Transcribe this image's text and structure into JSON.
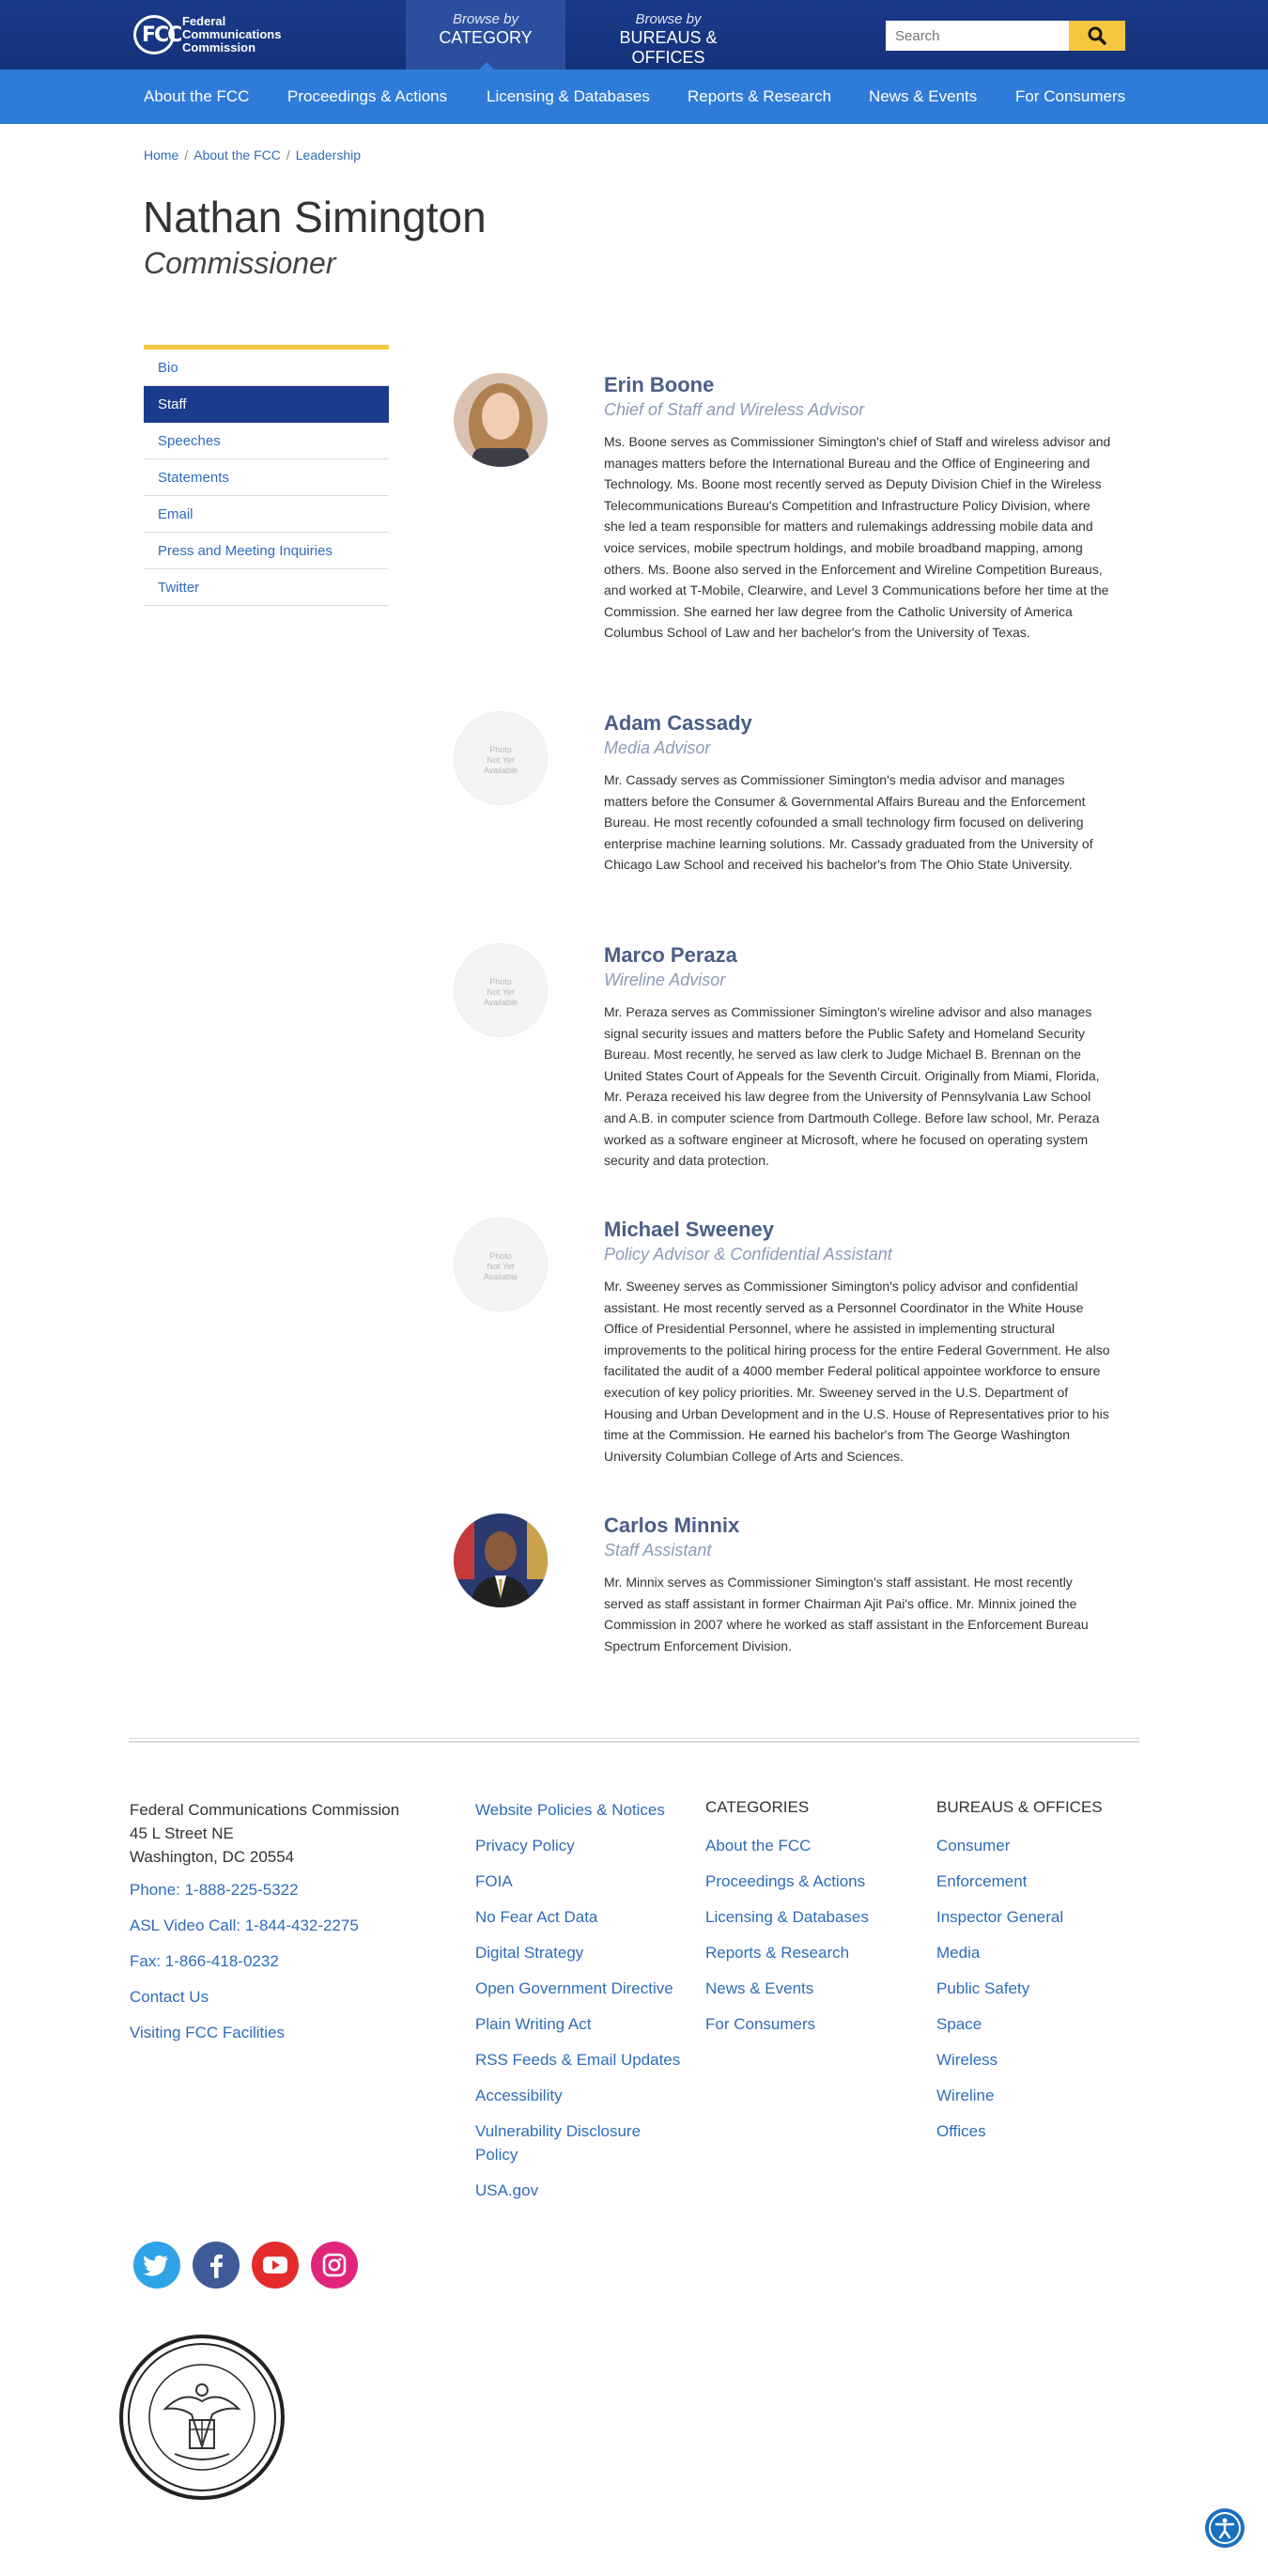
{
  "header": {
    "logo_lines": [
      "Federal",
      "Communications",
      "Commission"
    ],
    "logo_mark": "FCC",
    "browse_category_small": "Browse by",
    "browse_category_big": "CATEGORY",
    "browse_bureaus_small": "Browse by",
    "browse_bureaus_big": "BUREAUS & OFFICES",
    "search_placeholder": "Search",
    "search_icon": "search-icon"
  },
  "nav": [
    "About the FCC",
    "Proceedings & Actions",
    "Licensing & Databases",
    "Reports & Research",
    "News & Events",
    "For Consumers"
  ],
  "breadcrumb": [
    "Home",
    "About the FCC",
    "Leadership"
  ],
  "page": {
    "title": "Nathan Simington",
    "subtitle": "Commissioner"
  },
  "sidebar": [
    "Bio",
    "Staff",
    "Speeches",
    "Statements",
    "Email",
    "Press and Meeting Inquiries",
    "Twitter"
  ],
  "sidebar_active": "Staff",
  "placeholder_text": [
    "Photo",
    "Not Yet",
    "Available"
  ],
  "staff": [
    {
      "name": "Erin Boone",
      "role": "Chief of Staff and Wireless Advisor",
      "bio": "Ms. Boone serves as Commissioner Simington's chief of Staff and wireless advisor and manages matters before the International Bureau and the Office of Engineering and Technology. Ms. Boone most recently served as Deputy Division Chief in the Wireless Telecommunications Bureau's Competition and Infrastructure Policy Division, where she led a team responsible for matters and rulemakings addressing mobile data and voice services, mobile spectrum holdings, and mobile broadband mapping, among others. Ms. Boone also served in the Enforcement and Wireline Competition Bureaus, and worked at T-Mobile, Clearwire, and Level 3 Communications before her time at the Commission. She earned her law degree from the Catholic University of America Columbus School of Law and her bachelor's from the University of Texas.",
      "photo": "portrait"
    },
    {
      "name": "Adam Cassady",
      "role": "Media Advisor",
      "bio": "Mr. Cassady serves as Commissioner Simington's media advisor and manages matters before the Consumer & Governmental Affairs Bureau and the Enforcement Bureau. He most recently cofounded a small technology firm focused on delivering enterprise machine learning solutions. Mr. Cassady graduated from the University of Chicago Law School and received his bachelor's from The Ohio State University.",
      "photo": "placeholder"
    },
    {
      "name": "Marco Peraza",
      "role": "Wireline Advisor",
      "bio": "Mr. Peraza serves as Commissioner Simington's wireline advisor and also manages signal security issues and matters before the Public Safety and Homeland Security Bureau. Most recently, he served as law clerk to Judge Michael B. Brennan on the United States Court of Appeals for the Seventh Circuit. Originally from Miami, Florida, Mr. Peraza received his law degree from the University of Pennsylvania Law School and A.B. in computer science from Dartmouth College. Before law school, Mr. Peraza worked as a software engineer at Microsoft, where he focused on operating system security and data protection.",
      "photo": "placeholder"
    },
    {
      "name": "Michael Sweeney",
      "role": "Policy Advisor & Confidential Assistant",
      "bio": "Mr. Sweeney serves as Commissioner Simington's policy advisor and confidential assistant. He most recently served as a Personnel Coordinator in the White House Office of Presidential Personnel, where he assisted in implementing structural improvements to the political hiring process for the entire Federal Government. He also facilitated the audit of a 4000 member Federal political appointee workforce to ensure execution of key policy priorities. Mr. Sweeney served in the U.S. Department of Housing and Urban Development and in the U.S. House of Representatives prior to his time at the Commission. He earned his bachelor's from The George Washington University Columbian College of Arts and Sciences.",
      "photo": "placeholder"
    },
    {
      "name": "Carlos Minnix",
      "role": "Staff Assistant",
      "bio": "Mr. Minnix serves as Commissioner Simington's staff assistant. He most recently served as staff assistant in former Chairman Ajit Pai's office. Mr. Minnix joined the Commission in 2007 where he worked as staff assistant in the Enforcement Bureau Spectrum Enforcement Division.",
      "photo": "portrait"
    }
  ],
  "footer": {
    "address": [
      "Federal Communications Commission",
      "45 L Street NE",
      "Washington, DC 20554"
    ],
    "phone": "Phone: 1-888-225-5322",
    "asl": "ASL Video Call: 1-844-432-2275",
    "fax": "Fax: 1-866-418-0232",
    "contact": "Contact Us",
    "visiting": "Visiting FCC Facilities",
    "policies": [
      "Website Policies & Notices",
      "Privacy Policy",
      "FOIA",
      "No Fear Act Data",
      "Digital Strategy",
      "Open Government Directive",
      "Plain Writing Act",
      "RSS Feeds & Email Updates",
      "Accessibility",
      "Vulnerability Disclosure Policy",
      "USA.gov"
    ],
    "categories_head": "CATEGORIES",
    "categories": [
      "About the FCC",
      "Proceedings & Actions",
      "Licensing & Databases",
      "Reports & Research",
      "News & Events",
      "For Consumers"
    ],
    "bureaus_head": "BUREAUS & OFFICES",
    "bureaus": [
      "Consumer",
      "Enforcement",
      "Inspector General",
      "Media",
      "Public Safety",
      "Space",
      "Wireless",
      "Wireline",
      "Offices"
    ],
    "social": [
      {
        "name": "twitter-icon",
        "color": "#2fa3e6"
      },
      {
        "name": "facebook-icon",
        "color": "#3d5a99"
      },
      {
        "name": "youtube-icon",
        "color": "#e32b2b"
      },
      {
        "name": "instagram-icon",
        "color": "#e0257a"
      }
    ]
  },
  "colors": {
    "header_blue": "#14327a",
    "nav_blue": "#2f7bd9",
    "accent_yellow": "#f6c53f",
    "link_blue": "#2f6cb8",
    "active_sidebar": "#1b3c8e"
  }
}
